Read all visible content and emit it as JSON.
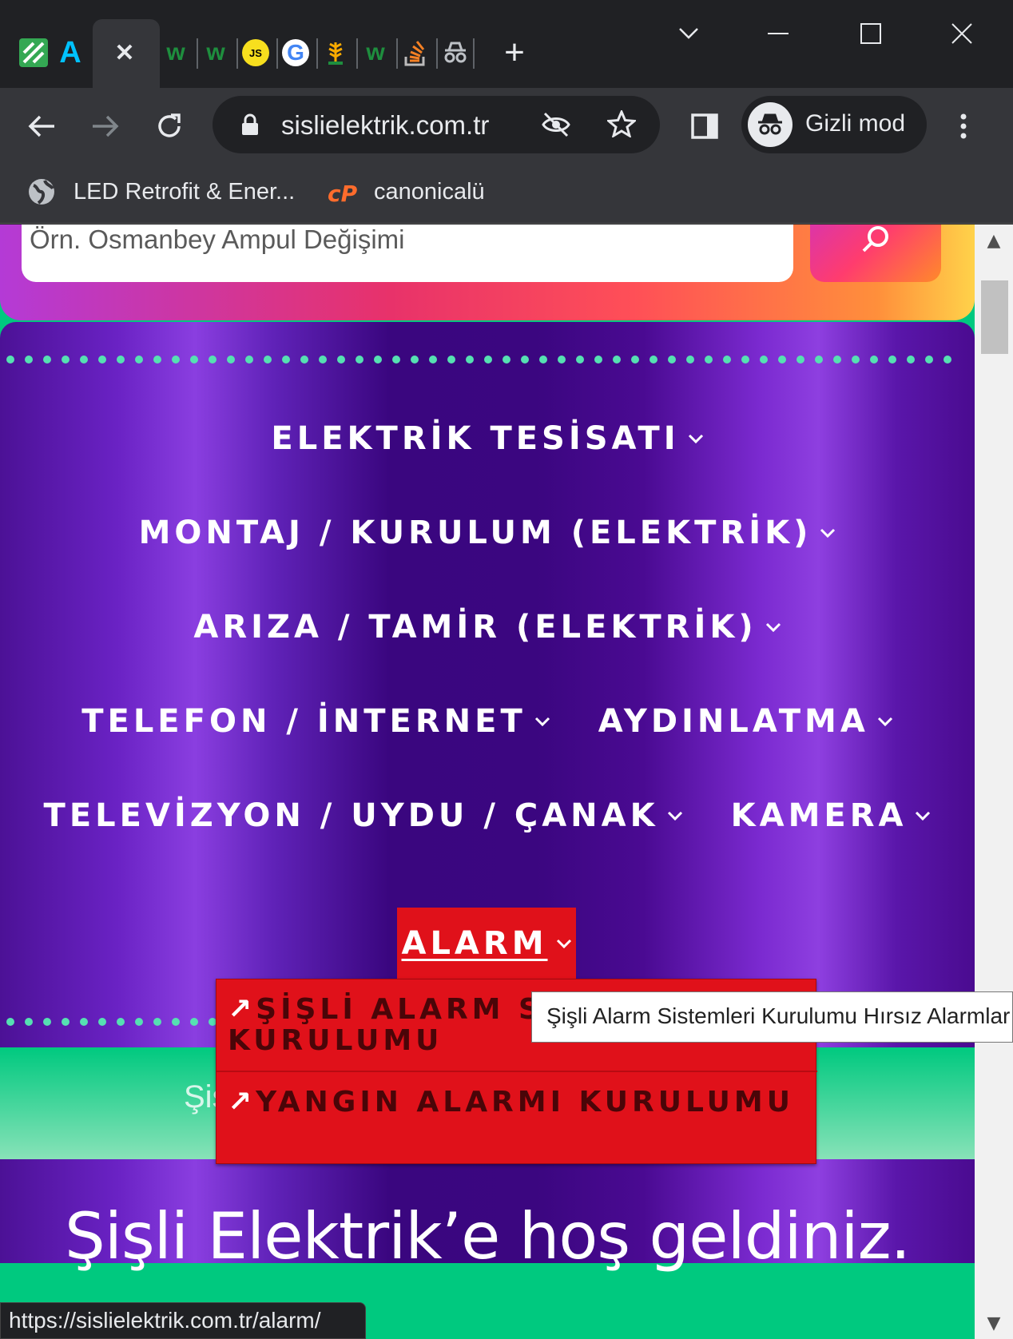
{
  "browser": {
    "tabs": [
      {
        "icon": "spreadsheet-favicon",
        "text": "",
        "color": "#34a853"
      },
      {
        "icon": "arc-a-favicon",
        "text": "A",
        "color": "#1a73e8"
      },
      {
        "icon": "w-favicon",
        "text": "w",
        "color": "#1e8e3e"
      },
      {
        "icon": "w-favicon",
        "text": "w",
        "color": "#1e8e3e"
      },
      {
        "icon": "js-favicon",
        "text": "JS",
        "color": "#f7df1e"
      },
      {
        "icon": "google-favicon",
        "text": "G",
        "color": "#4285f4"
      },
      {
        "icon": "wheat-favicon",
        "text": "",
        "color": "#f9ab00"
      },
      {
        "icon": "w-favicon",
        "text": "w",
        "color": "#1e8e3e"
      },
      {
        "icon": "stackoverflow-favicon",
        "text": "",
        "color": "#f48024"
      },
      {
        "icon": "incognito-favicon",
        "text": "",
        "color": "#bdc1c6"
      }
    ],
    "url": "sislielektrik.com.tr",
    "incognito_label": "Gizli mod",
    "bookmarks": [
      {
        "label": "LED Retrofit & Ener...",
        "icon": "globe-icon"
      },
      {
        "label": "canonicalü",
        "icon": "cpanel-icon"
      }
    ]
  },
  "page": {
    "search_placeholder": "Örn. Osmanbey Ampul Değişimi",
    "menu": {
      "row1": [
        "ELEKTRİK TESİSATI"
      ],
      "row2": [
        "MONTAJ / KURULUM (ELEKTRİK)"
      ],
      "row3": [
        "ARIZA / TAMİR (ELEKTRİK)"
      ],
      "row4": [
        "TELEFON / İNTERNET",
        "AYDINLATMA"
      ],
      "row5": [
        "TELEVİZYON / UYDU / ÇANAK",
        "KAMERA"
      ],
      "active": "ALARM"
    },
    "dropdown": {
      "arrow": "↗",
      "items": [
        "ŞİŞLİ ALARM SİSTEMLERİ KURULUMU",
        "YANGIN ALARMI KURULUMU"
      ]
    },
    "tooltip": "Şişli Alarm Sistemleri Kurulumu Hırsız Alarmları",
    "hero_partial": "Şiş",
    "welcome": "Şişli Elektrik’e hoş geldiniz.",
    "next_heading_partial": "..."
  },
  "status_url": "https://sislielektrik.com.tr/alarm/",
  "colors": {
    "accent_red": "#e0111a",
    "menu_purple": "#4a0a92",
    "hero_green": "#00c97f",
    "dot_mint": "#56e0b2"
  }
}
